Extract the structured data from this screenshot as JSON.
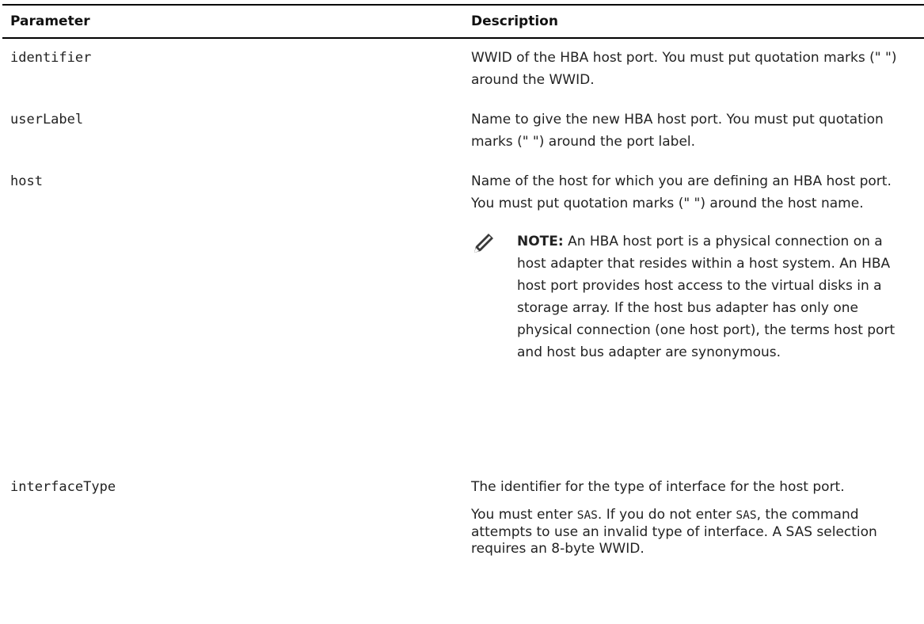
{
  "table": {
    "header": {
      "parameter": "Parameter",
      "description": "Description"
    },
    "rows": [
      {
        "param": "identifier",
        "description": "WWID of the HBA host port. You must put quotation marks (\" \") around the WWID."
      },
      {
        "param": "userLabel",
        "description": "Name to give the new HBA host port. You must put quotation marks (\" \") around the port label."
      },
      {
        "param": "host",
        "description": "Name of the host for which you are defining an HBA host port. You must put quotation marks (\" \") around the host name.",
        "note": {
          "icon": "note-pencil-icon",
          "label": "NOTE:",
          "text": " An HBA host port is a physical connection on a host adapter that resides within a host system. An HBA host port provides host access to the virtual disks in a storage array. If the host bus adapter has only one physical connection (one host port), the terms host port and host bus adapter are synonymous."
        }
      },
      {
        "param": "interfaceType",
        "description": "The identifier for the type of interface for the host port.",
        "para2": {
          "part1": "You must enter ",
          "code1": "SAS",
          "part2": ". If you do not enter ",
          "code2": "SAS",
          "part3": ", the command attempts to use an invalid type of interface. A SAS selection requires an 8-byte WWID."
        }
      }
    ]
  }
}
